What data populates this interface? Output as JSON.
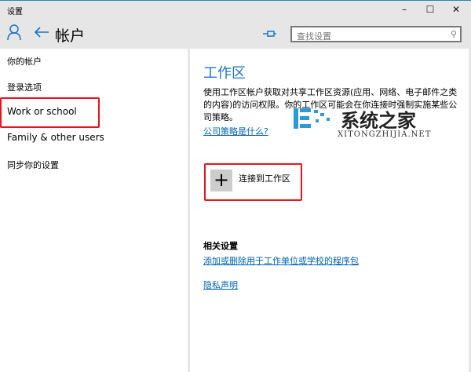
{
  "window": {
    "title": "设置",
    "minimize": "–",
    "maximize": "☐",
    "close": "✕"
  },
  "header": {
    "title": "帐户",
    "search_placeholder": "查找设置"
  },
  "sidebar": {
    "items": [
      {
        "label": "你的帐户"
      },
      {
        "label": "登录选项"
      },
      {
        "label": "Work or school"
      },
      {
        "label": "Family & other users"
      },
      {
        "label": "同步你的设置"
      }
    ],
    "selected": "Work or school"
  },
  "main": {
    "title": "工作区",
    "description": "使用工作区帐户获取对共享工作区资源(应用、网络、电子邮件之类的内容)的访问权限。你的工作区可能会在你连接时强制实施某些公司策略。",
    "policy_link": "公司策略是什么?",
    "connect_label": "连接到工作区",
    "related_heading": "相关设置",
    "related_link": "添加或删除用于工作单位或学校的程序包",
    "privacy_link": "隐私声明"
  },
  "watermark": {
    "cn": "系统之家",
    "en": "XITONGZHIJIA.NET"
  },
  "colors": {
    "accent": "#1a73c8",
    "highlight": "#e8141e"
  }
}
